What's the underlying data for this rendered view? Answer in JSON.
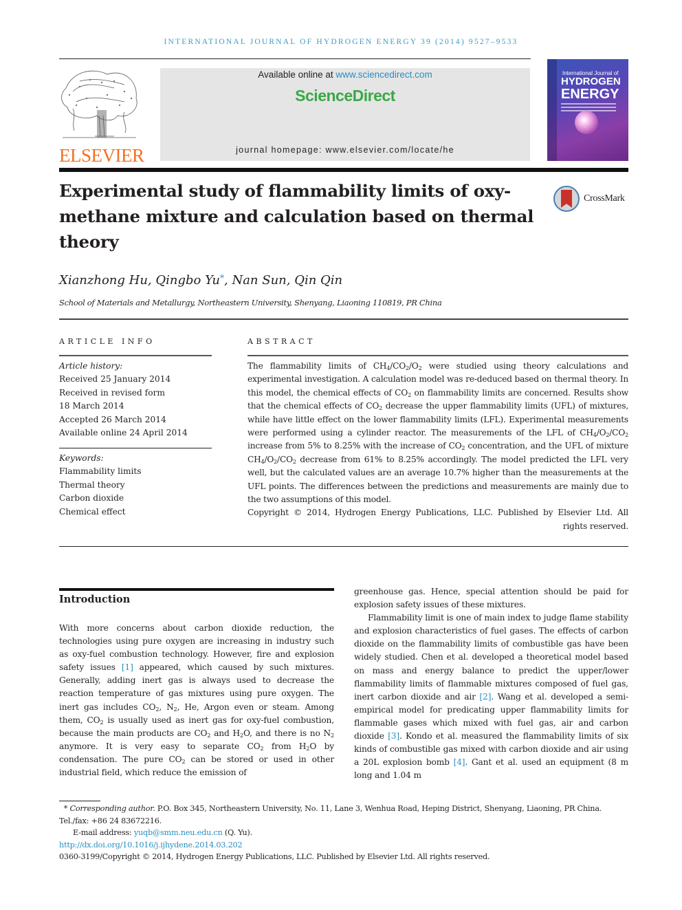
{
  "running_head": "INTERNATIONAL JOURNAL OF HYDROGEN ENERGY 39 (2014) 9527–9533",
  "header": {
    "publisher_logo_text": "ELSEVIER",
    "available_online_prefix": "Available online at ",
    "available_online_link": "www.sciencedirect.com",
    "sciencedirect_brand": "ScienceDirect",
    "journal_homepage": "journal homepage: www.elsevier.com/locate/he",
    "cover": {
      "line1": "International Journal of",
      "line2": "HYDROGEN",
      "line3": "ENERGY"
    },
    "crossmark_label": "CrossMark"
  },
  "article": {
    "title": "Experimental study of flammability limits of oxy-methane mixture and calculation based on thermal theory",
    "authors": {
      "part1": "Xianzhong Hu, Qingbo Yu",
      "star": "*",
      "part2": ", Nan Sun, Qin Qin"
    },
    "affiliation": "School of Materials and Metallurgy, Northeastern University, Shenyang, Liaoning 110819, PR China"
  },
  "article_info": {
    "heading": "ARTICLE INFO",
    "history_label": "Article history:",
    "history": [
      "Received 25 January 2014",
      "Received in revised form",
      "18 March 2014",
      "Accepted 26 March 2014",
      "Available online 24 April 2014"
    ],
    "keywords_label": "Keywords:",
    "keywords": [
      "Flammability limits",
      "Thermal theory",
      "Carbon dioxide",
      "Chemical effect"
    ]
  },
  "abstract": {
    "heading": "ABSTRACT",
    "s1a": "The flammability limits of CH",
    "s1b": "4",
    "s1c": "/CO",
    "s1d": "2",
    "s1e": "/O",
    "s1f": "2",
    "s1g": " were studied using theory calculations and experimental investigation. A calculation model was re-deduced based on thermal theory. In this model, the chemical effects of CO",
    "s1h": "2",
    "s1i": " on flammability limits are concerned. Results show that the chemical effects of CO",
    "s1j": "2",
    "s1k": " decrease the upper flammability limits (UFL) of mixtures, while have little effect on the lower flammability limits (LFL). Experimental measurements were performed using a cylinder reactor. The measurements of the LFL of CH",
    "s1l": "4",
    "s1m": "/O",
    "s1n": "2",
    "s1o": "/CO",
    "s1p": "2",
    "s1q": " increase from 5% to 8.25% with the increase of CO",
    "s1r": "2",
    "s1s": " concentration, and the UFL of mixture CH",
    "s1t": "4",
    "s1u": "/O",
    "s1v": "2",
    "s1w": "/CO",
    "s1x": "2",
    "s1y": " decrease from 61% to 8.25% accordingly. The model predicted the LFL very well, but the calculated values are an average 10.7% higher than the measurements at the UFL points. The differences between the predictions and measurements are mainly due to the two assumptions of this model.",
    "copyright": "Copyright © 2014, Hydrogen Energy Publications, LLC. Published by Elsevier Ltd. All rights reserved."
  },
  "introduction": {
    "heading": "Introduction",
    "left": {
      "t1": "With more concerns about carbon dioxide reduction, the technologies using pure oxygen are increasing in industry such as oxy-fuel combustion technology. However, fire and explosion safety issues ",
      "ref1": "[1]",
      "t2": " appeared, which caused by such mixtures. Generally, adding inert gas is always used to decrease the reaction temperature of gas mixtures using pure oxygen. The inert gas includes CO",
      "t3": ", N",
      "t4": ", He, Argon even or steam. Among them, CO",
      "t5": " is usually used as inert gas for oxy-fuel combustion, because the main products are CO",
      "t6": " and H",
      "t7": "O, and there is no N",
      "t8": " anymore. It is very easy to separate CO",
      "t9": " from H",
      "t10": "O by condensation. The pure CO",
      "t11": " can be stored or used in other industrial field, which reduce the emission of",
      "sub2": "2"
    },
    "right": {
      "p1": "greenhouse gas. Hence, special attention should be paid for explosion safety issues of these mixtures.",
      "p2a": "Flammability limit is one of main index to judge flame stability and explosion characteristics of fuel gases. The effects of carbon dioxide on the flammability limits of combustible gas have been widely studied. Chen et al. developed a theoretical model based on mass and energy balance to predict the upper/lower flammability limits of flammable mixtures composed of fuel gas, inert carbon dioxide and air ",
      "ref2": "[2]",
      "p2b": ". Wang et al. developed a semi-empirical model for predicating upper flammability limits for flammable gases which mixed with fuel gas, air and carbon dioxide ",
      "ref3": "[3]",
      "p2c": ". Kondo et al. measured the flammability limits of six kinds of combustible gas mixed with carbon dioxide and air using a 20L explosion bomb ",
      "ref4": "[4]",
      "p2d": ". Gant et al. used an equipment (8 m long and 1.04 m"
    }
  },
  "footnotes": {
    "star": "*",
    "corr_label": "Corresponding author.",
    "corr_text": " P.O. Box 345, Northeastern University, No. 11, Lane 3, Wenhua Road, Heping District, Shenyang, Liaoning, PR China. Tel./fax: +86 24 83672216.",
    "email_label": "E-mail address: ",
    "email": "yuqb@smm.neu.edu.cn",
    "email_suffix": " (Q. Yu).",
    "doi": "http://dx.doi.org/10.1016/j.ijhydene.2014.03.202",
    "issn_copyright": "0360-3199/Copyright © 2014, Hydrogen Energy Publications, LLC. Published by Elsevier Ltd. All rights reserved."
  }
}
